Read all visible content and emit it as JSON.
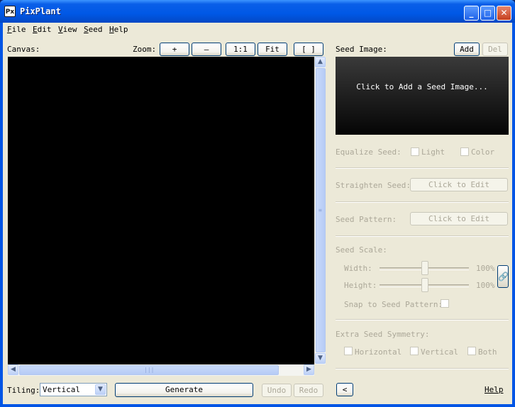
{
  "window": {
    "title": "PixPlant",
    "icon_text": "Px",
    "minimize_glyph": "_",
    "maximize_glyph": "□",
    "close_glyph": "✕"
  },
  "menu": [
    {
      "label": "File",
      "key": "F",
      "rest": "ile"
    },
    {
      "label": "Edit",
      "key": "E",
      "rest": "dit"
    },
    {
      "label": "View",
      "key": "V",
      "rest": "iew"
    },
    {
      "label": "Seed",
      "key": "S",
      "rest": "eed"
    },
    {
      "label": "Help",
      "key": "H",
      "rest": "elp"
    }
  ],
  "canvas": {
    "label": "Canvas:",
    "zoom_label": "Zoom:",
    "zoom_in": "+",
    "zoom_out": "—",
    "zoom_actual": "1:1",
    "zoom_fit": "Fit",
    "zoom_frame": "[ ]"
  },
  "scroll": {
    "up": "▲",
    "down": "▼",
    "left": "◀",
    "right": "▶",
    "grip_v": "≡",
    "grip_h": "|||"
  },
  "seed": {
    "label": "Seed Image:",
    "add": "Add",
    "del": "Del",
    "placeholder": "Click to Add a Seed Image...",
    "equalize_label": "Equalize Seed:",
    "equalize_light": "Light",
    "equalize_color": "Color",
    "straighten_label": "Straighten Seed:",
    "straighten_btn": "Click to Edit",
    "pattern_label": "Seed Pattern:",
    "pattern_btn": "Click to Edit",
    "scale_label": "Seed Scale:",
    "width_label": "Width:",
    "width_value": "100%",
    "height_label": "Height:",
    "height_value": "100%",
    "link_glyph": "🔗",
    "snap_label": "Snap to Seed Pattern:",
    "symmetry_label": "Extra Seed Symmetry:",
    "sym_horizontal": "Horizontal",
    "sym_vertical": "Vertical",
    "sym_both": "Both"
  },
  "bottom": {
    "tiling_label": "Tiling:",
    "tiling_value": "Vertical",
    "generate": "Generate",
    "undo": "Undo",
    "redo": "Redo",
    "collapse_glyph": "<",
    "help": "Help"
  }
}
